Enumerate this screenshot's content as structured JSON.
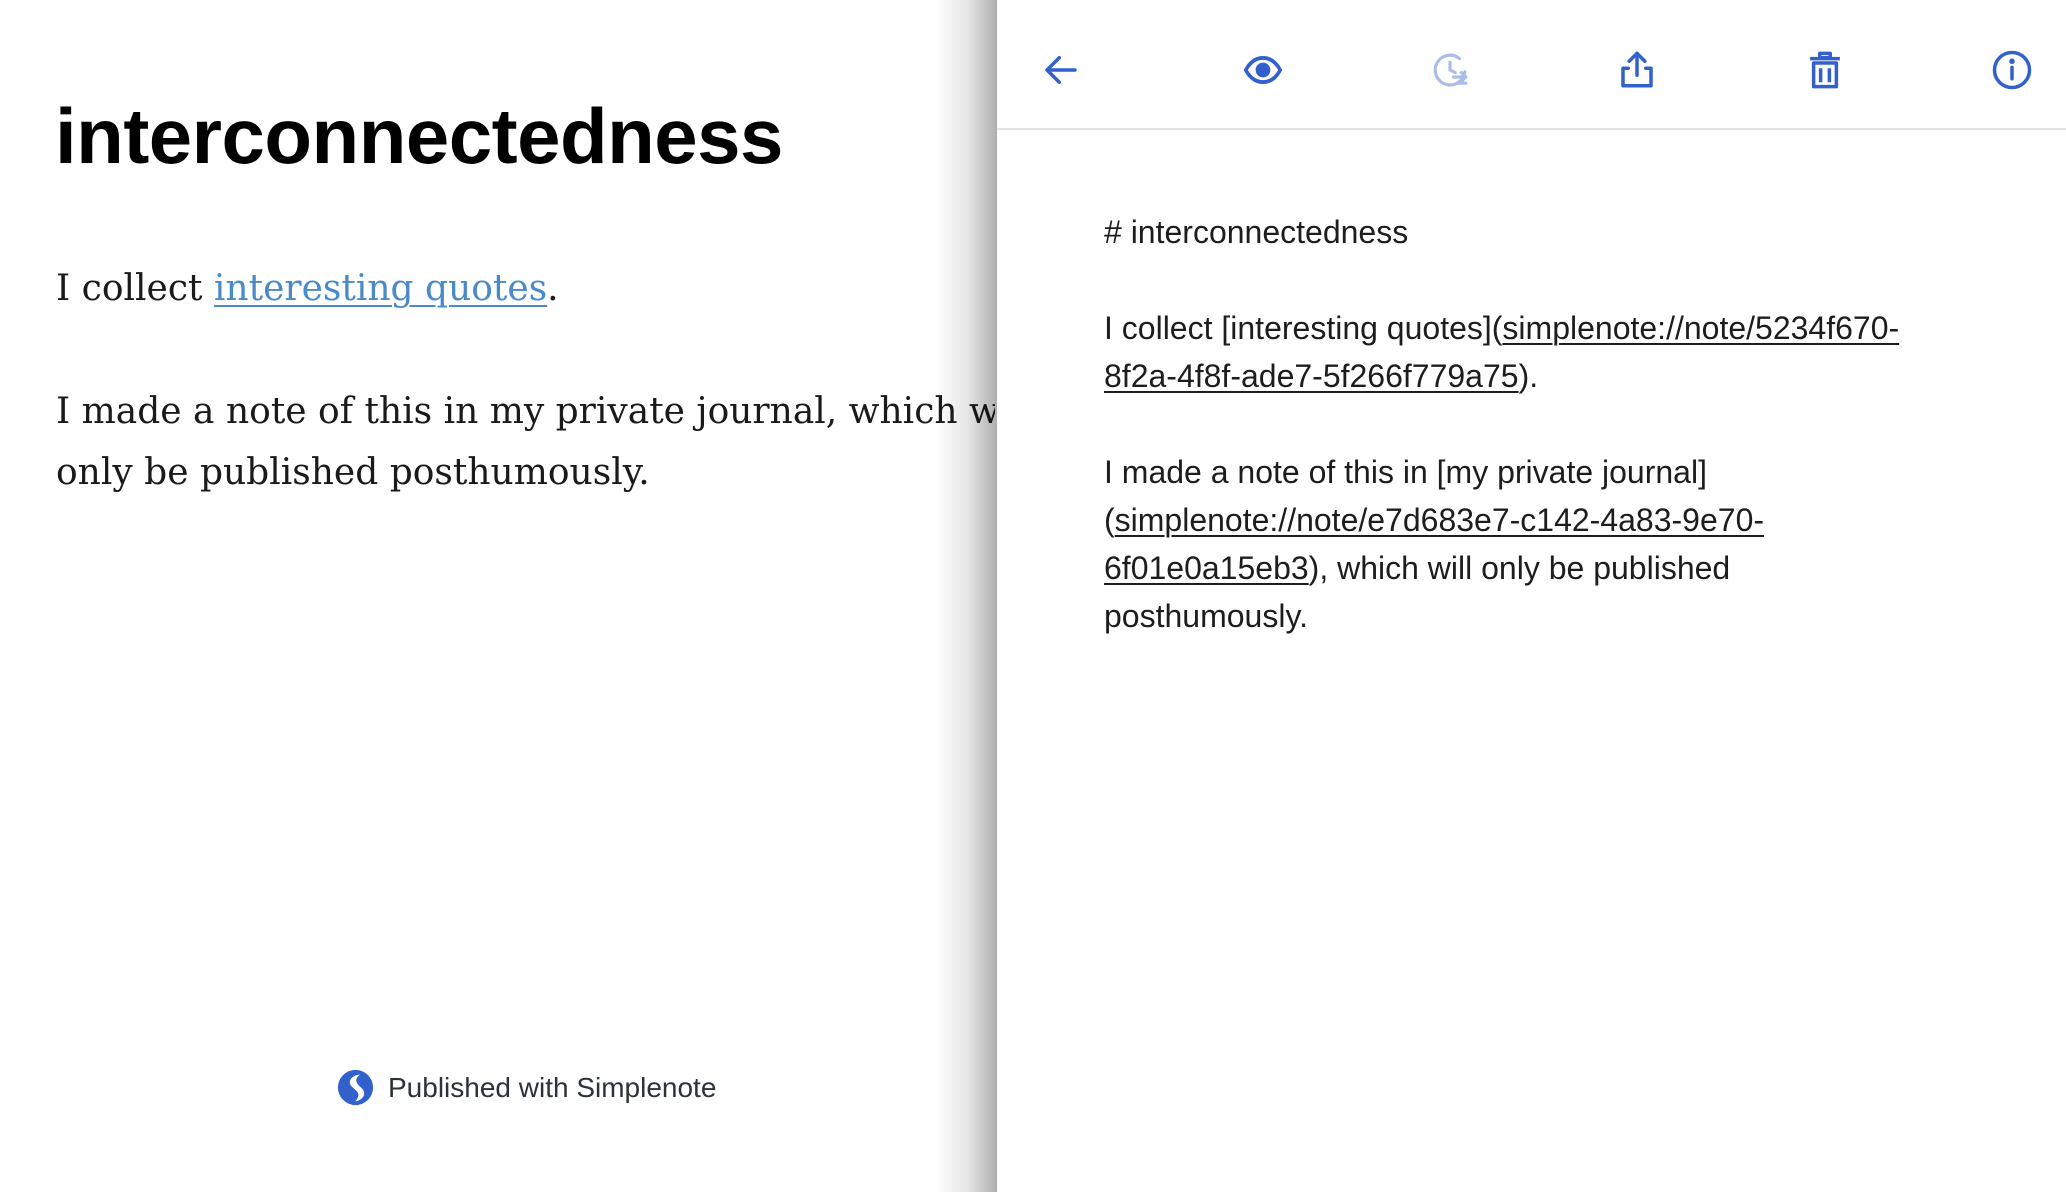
{
  "published": {
    "title": "interconnectedness",
    "para1": {
      "before": "I collect ",
      "link": "interesting quotes",
      "after": "."
    },
    "para2": {
      "line1": "I made a note of this in my private journal, which will",
      "line2": "only be published posthumously."
    },
    "footer": {
      "text": "Published with Simplenote",
      "logo_color": "#3361cc"
    },
    "link_color": "#4a8ac9"
  },
  "toolbar": {
    "icon_color": "#3361cc",
    "disabled_icon_color": "#a9bde8",
    "items": [
      {
        "name": "back",
        "icon": "arrow-left-icon"
      },
      {
        "name": "preview",
        "icon": "eye-icon"
      },
      {
        "name": "history",
        "icon": "history-icon",
        "disabled": true
      },
      {
        "name": "share",
        "icon": "share-icon"
      },
      {
        "name": "trash",
        "icon": "trash-icon"
      },
      {
        "name": "info",
        "icon": "info-icon"
      }
    ]
  },
  "editor": {
    "heading": "# interconnectedness",
    "para1": {
      "prefix": "I collect [interesting quotes](",
      "url_line1": "simplenote://note/5234f670-",
      "url_line2": "8f2a-4f8f-ade7-5f266f779a75",
      "suffix": ")."
    },
    "para2": {
      "line1": "I made a note of this in [my private journal]",
      "paren_open": "(",
      "url_line1": "simplenote://note/e7d683e7-c142-4a83-9e70-",
      "url_line2": "6f01e0a15eb3",
      "rest": "), which will only be published",
      "line4": "posthumously."
    }
  }
}
